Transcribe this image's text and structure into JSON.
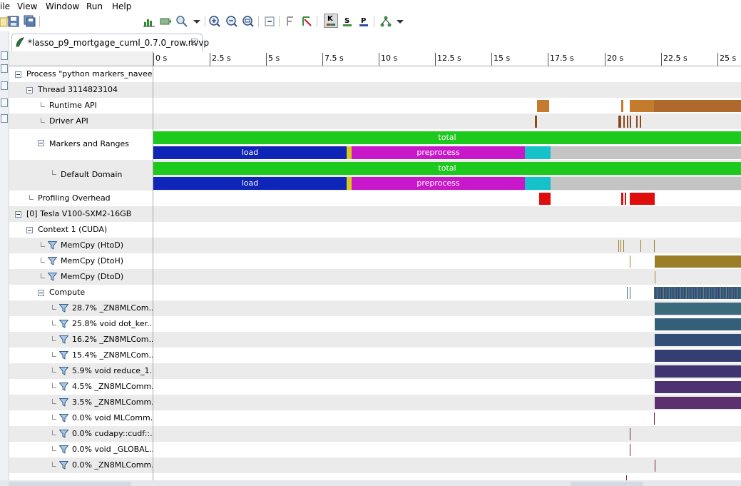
{
  "menu": {
    "items": [
      "ile",
      "View",
      "Window",
      "Run",
      "Help"
    ]
  },
  "tab": {
    "title": "*lasso_p9_mortgage_cuml_0.7.0_row.nvvp"
  },
  "toolbar": {
    "toggle_k": "K",
    "toggle_s": "S",
    "toggle_p": "P"
  },
  "ruler": {
    "ticks": [
      "0 s",
      "2.5 s",
      "5 s",
      "7.5 s",
      "10 s",
      "12.5 s",
      "15 s",
      "17.5 s",
      "20 s",
      "22.5 s",
      "25 s"
    ]
  },
  "tree": {
    "process": "Process \"python markers_navee...",
    "thread": "Thread 3114823104",
    "runtime_api": "Runtime API",
    "driver_api": "Driver API",
    "markers_ranges": "Markers and Ranges",
    "default_domain": "Default Domain",
    "profiling_overhead": "Profiling Overhead",
    "device": "[0] Tesla V100-SXM2-16GB",
    "context": "Context 1 (CUDA)",
    "memcpy_htod": "MemCpy (HtoD)",
    "memcpy_dtoh": "MemCpy (DtoH)",
    "memcpy_dtod": "MemCpy (DtoD)",
    "compute": "Compute",
    "kernels": [
      "28.7% _ZN8MLCom...",
      "25.8% void dot_ker...",
      "16.2% _ZN8MLCom...",
      "15.4% _ZN8MLCom...",
      "5.9% void reduce_1...",
      "4.5% _ZN8MLComm...",
      "3.5% _ZN8MLComm...",
      "0.0% void MLComm...",
      "0.0% cudapy::cudf::...",
      "0.0% void _GLOBAL...",
      "0.0% _ZN8MLComm..."
    ]
  },
  "ranges": {
    "total": "total",
    "load": "load",
    "preprocess": "preprocess"
  },
  "colors": {
    "runtime_api": "#c47b2e",
    "driver_api": "#8c4a20",
    "total": "#1ec91e",
    "load": "#0f25b8",
    "yellow": "#d8c81a",
    "preprocess": "#c918c9",
    "cyan": "#16c2c9",
    "gray": "#c4c4c4",
    "overhead": "#e00d0d",
    "memcpy": "#9c7d28",
    "compute": "#4a6a8a",
    "kernel_1": "#3a6b7c",
    "kernel_2": "#335f79",
    "kernel_3": "#324e76",
    "kernel_4": "#343e72",
    "kernel_5": "#3d3670",
    "kernel_6": "#4e3372",
    "kernel_7": "#5c2f6e"
  }
}
